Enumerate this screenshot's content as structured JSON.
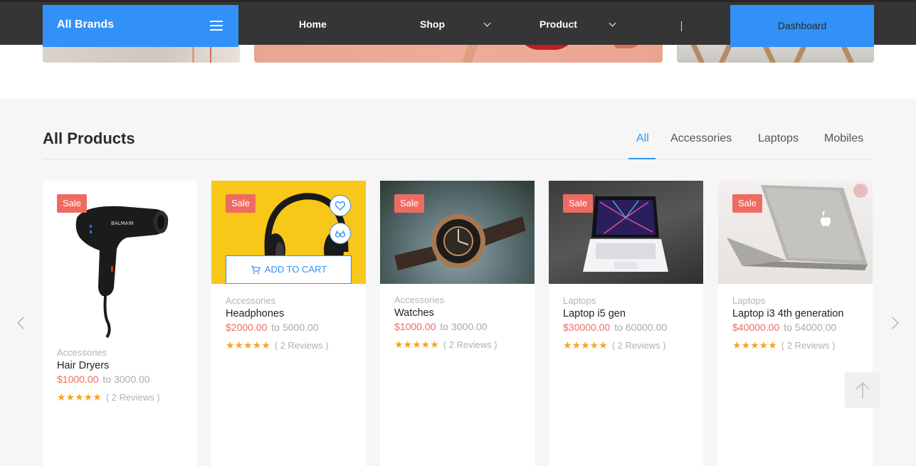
{
  "navbar": {
    "brand": "All Brands",
    "items": [
      {
        "label": "Home"
      },
      {
        "label": "Shop"
      },
      {
        "label": "Product"
      }
    ],
    "dashboard_label": "Dashboard",
    "accent_color": "#3291f6",
    "background_color": "#353535"
  },
  "products_section": {
    "title": "All Products",
    "tabs": [
      {
        "label": "All",
        "active": true
      },
      {
        "label": "Accessories",
        "active": false
      },
      {
        "label": "Laptops",
        "active": false
      },
      {
        "label": "Mobiles",
        "active": false
      }
    ]
  },
  "products": [
    {
      "badge": "Sale",
      "category": "Accessories",
      "name": "Hair Dryers",
      "price_low": "$1000.00",
      "price_high": "to 3000.00",
      "stars": "★★★★★",
      "reviews": "( 2 Reviews )",
      "image": "hair-dryer"
    },
    {
      "badge": "Sale",
      "category": "Accessories",
      "name": "Headphones",
      "price_low": "$2000.00",
      "price_high": "to 5000.00",
      "stars": "★★★★★",
      "reviews": "( 2 Reviews )",
      "image": "headphones",
      "add_to_cart_label": "ADD TO CART"
    },
    {
      "badge": "Sale",
      "category": "Accessories",
      "name": "Watches",
      "price_low": "$1000.00",
      "price_high": "to 3000.00",
      "stars": "★★★★★",
      "reviews": "( 2 Reviews )",
      "image": "watch"
    },
    {
      "badge": "Sale",
      "category": "Laptops",
      "name": "Laptop i5 gen",
      "price_low": "$30000.00",
      "price_high": "to 60000.00",
      "stars": "★★★★★",
      "reviews": "( 2 Reviews )",
      "image": "laptop-rog"
    },
    {
      "badge": "Sale",
      "category": "Laptops",
      "name": "Laptop i3 4th generation",
      "price_low": "$40000.00",
      "price_high": "to 54000.00",
      "stars": "★★★★★",
      "reviews": "( 2 Reviews )",
      "image": "laptop-mac"
    }
  ],
  "icons": {
    "menu": "hamburger-icon",
    "wishlist": "heart-icon",
    "compare": "glasses-icon",
    "cart": "cart-icon",
    "prev": "chevron-left-icon",
    "next": "chevron-right-icon",
    "scroll_top": "arrow-up-icon"
  },
  "colors": {
    "sale_badge": "#ee6b63",
    "price_low": "#ee6b63",
    "stars": "#f5a623"
  }
}
